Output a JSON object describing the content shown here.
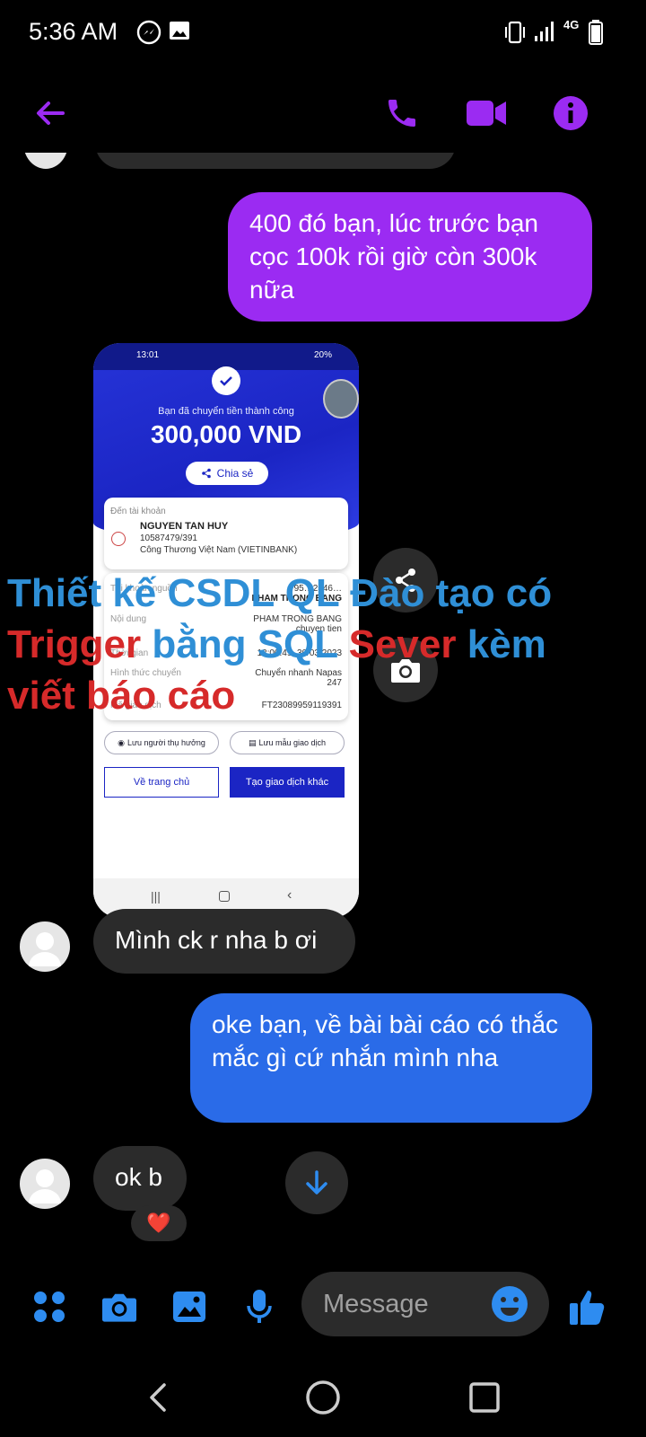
{
  "status_bar": {
    "time": "5:36 AM",
    "network": "4G"
  },
  "header": {
    "back_icon": "arrow-left-icon",
    "call_icon": "phone-icon",
    "video_icon": "video-camera-icon",
    "info_icon": "info-icon",
    "accent_color": "#9b2bf2"
  },
  "messages": [
    {
      "direction": "out",
      "text": "400 đó bạn, lúc trước bạn cọc 100k rồi giờ còn 300k nữa",
      "color": "#9b2bf2"
    },
    {
      "direction": "out",
      "type": "image"
    },
    {
      "direction": "in",
      "text": "Mình ck r nha b ơi"
    },
    {
      "direction": "out",
      "text": "oke bạn, về bài bài cáo có thắc mắc gì cứ nhắn mình nha",
      "color": "#2a6be8"
    },
    {
      "direction": "in",
      "text": "ok b",
      "reaction": "❤️"
    }
  ],
  "shared_image": {
    "status_time": "13:01",
    "status_battery": "20%",
    "success_text": "Bạn đã chuyển tiền thành công",
    "amount": "300,000 VND",
    "share_label": "Chia sẻ",
    "to_account_label": "Đến tài khoản",
    "recipient_name": "NGUYEN TAN HUY",
    "recipient_account": "10587479/391",
    "recipient_bank": "Công Thương Việt Nam (VIETINBANK)",
    "rows": [
      {
        "label": "Tài khoản nguồn",
        "value": "95…2546…",
        "value2": "PHAM TRONG BANG"
      },
      {
        "label": "Nội dung",
        "value": "PHAM TRONG BANG",
        "value2": "chuyen tien"
      },
      {
        "label": "Thời gian",
        "value": "13:00:49, 30/03/2023"
      },
      {
        "label": "Hình thức chuyển",
        "value": "Chuyển nhanh Napas",
        "value2": "247"
      },
      {
        "label": "Mã giao dịch",
        "value": "FT23089959119391"
      }
    ],
    "save_beneficiary": "Lưu người thụ hưởng",
    "save_template": "Lưu mẫu giao dịch",
    "home_button": "Về trang chủ",
    "new_transaction_button": "Tạo giao dịch khác"
  },
  "watermark": {
    "part1": "Thiết kế CSDL QL Đào tạo có",
    "part2_red": "Trigger",
    "part2_blue": " bằng SQL ",
    "part2_red2": "Sever",
    "part2_blue2": " kèm",
    "part3": "viết báo cáo",
    "blue_color": "#2f8fd6",
    "red_color": "#d62a2a"
  },
  "composer": {
    "placeholder": "Message",
    "apps_icon": "grid-icon",
    "camera_icon": "camera-icon",
    "gallery_icon": "image-icon",
    "mic_icon": "microphone-icon",
    "emoji_icon": "emoji-icon",
    "like_icon": "thumbs-up-icon"
  },
  "floating": {
    "share_icon": "share-icon",
    "camera_icon": "camera-icon",
    "scroll_down_icon": "arrow-down-icon"
  }
}
